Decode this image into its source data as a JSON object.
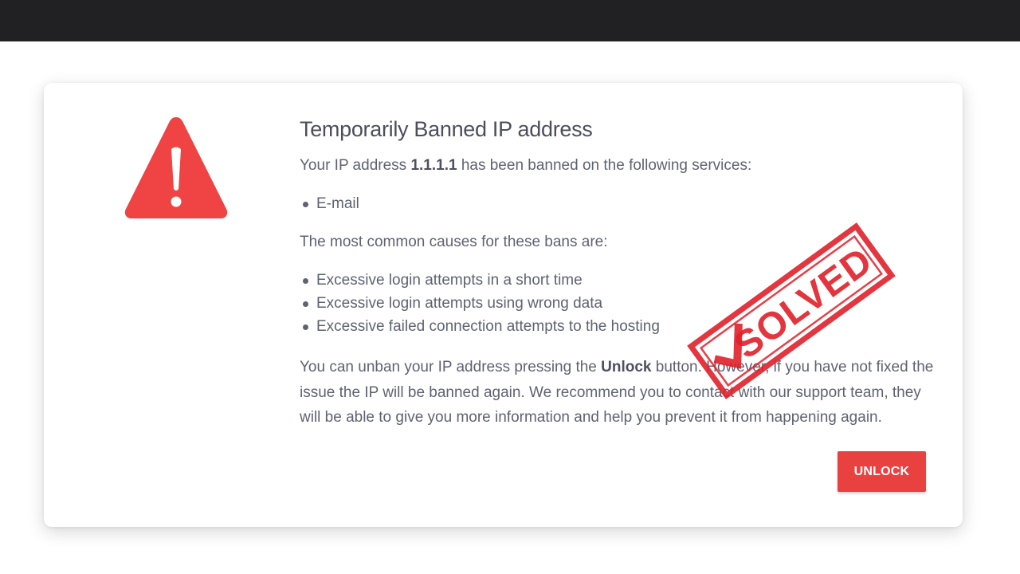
{
  "header": {
    "bar_color": "#212123"
  },
  "warning": {
    "icon": "warning-triangle-icon",
    "color": "#f04343"
  },
  "content": {
    "title": "Temporarily Banned IP address",
    "intro_prefix": "Your IP address ",
    "ip_address": "1.1.1.1",
    "intro_suffix": " has been banned on the following services:",
    "services": [
      "E-mail"
    ],
    "causes_heading": "The most common causes for these bans are:",
    "causes": [
      "Excessive login attempts in a short time",
      "Excessive login attempts using wrong data",
      "Excessive failed connection attempts to the hosting"
    ],
    "unban_prefix": "You can unban your IP address pressing the ",
    "unban_button_ref": "Unlock",
    "unban_suffix": " button. However, if you have not fixed the issue the IP will be banned again. We recommend you to contact with our support team, they will be able to give you more information and help you prevent it from happening again."
  },
  "actions": {
    "unlock_label": "UNLOCK",
    "unlock_color": "#e8413f"
  },
  "stamp": {
    "text": "SOLVED",
    "color": "#e0202a"
  }
}
